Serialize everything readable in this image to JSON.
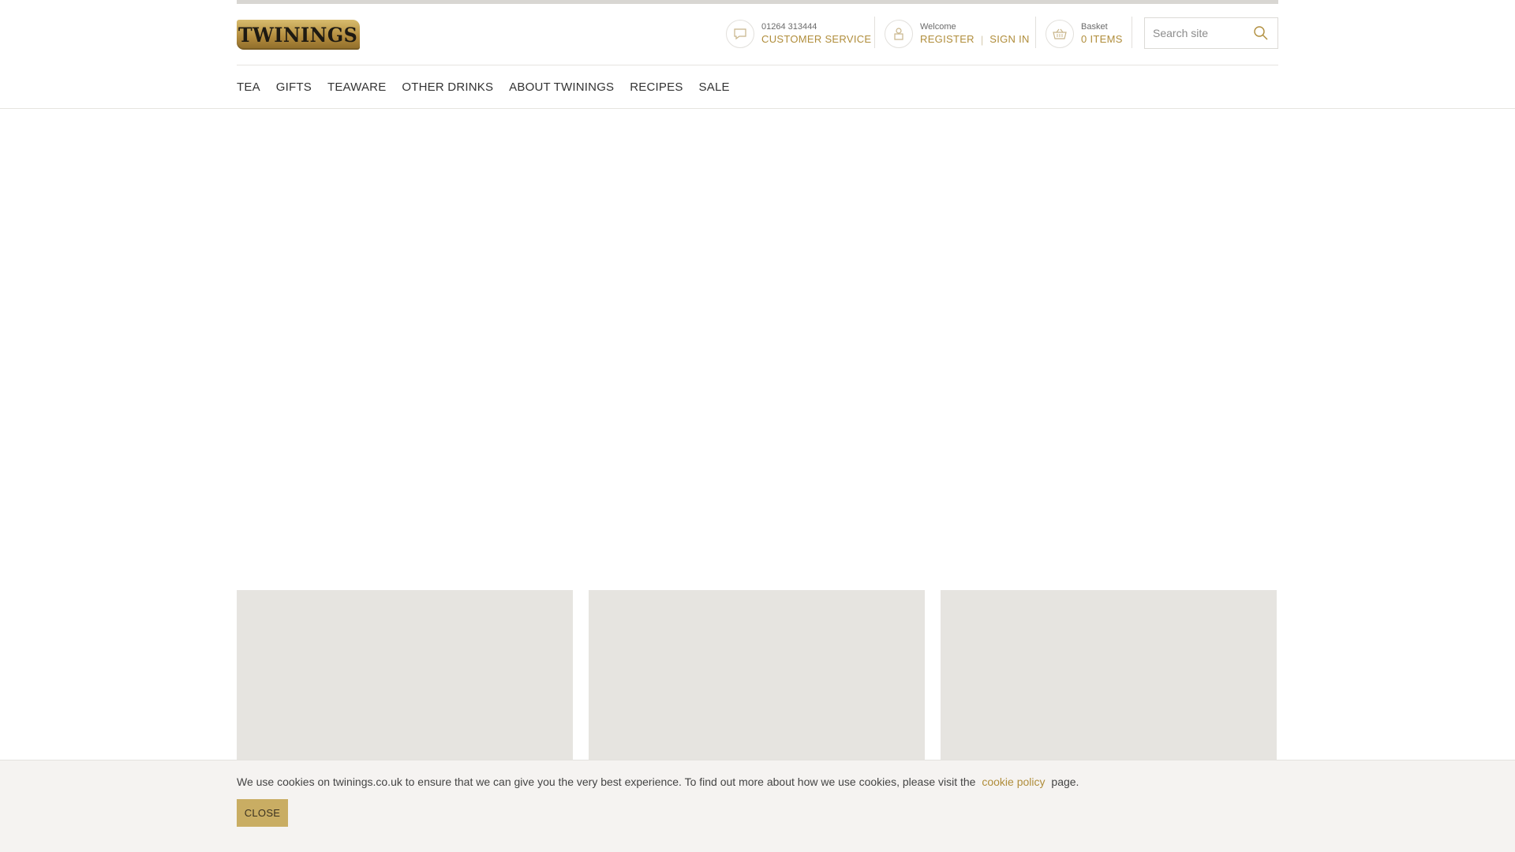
{
  "brand": {
    "logo_text": "TWININGS",
    "accent_color": "#b08d3b"
  },
  "header": {
    "customer_service": {
      "phone": "01264 313444",
      "label": "CUSTOMER SERVICE",
      "icon": "chat-bubble-icon"
    },
    "account": {
      "greeting": "Welcome",
      "register": "REGISTER",
      "sign_in": "SIGN IN",
      "icon": "user-bag-icon"
    },
    "basket": {
      "label": "Basket",
      "items": "0 ITEMS",
      "icon": "basket-icon"
    },
    "search": {
      "placeholder": "Search site",
      "icon": "search-icon"
    }
  },
  "nav": {
    "items": [
      "TEA",
      "GIFTS",
      "TEAWARE",
      "OTHER DRINKS",
      "ABOUT TWININGS",
      "RECIPES",
      "SALE"
    ]
  },
  "cookie": {
    "text_before": "We use cookies on twinings.co.uk to ensure that we can give you the very best experience. To find out more about how we use cookies, please visit the",
    "link_text": "cookie policy",
    "text_after": "page.",
    "close_label": "CLOSE"
  }
}
